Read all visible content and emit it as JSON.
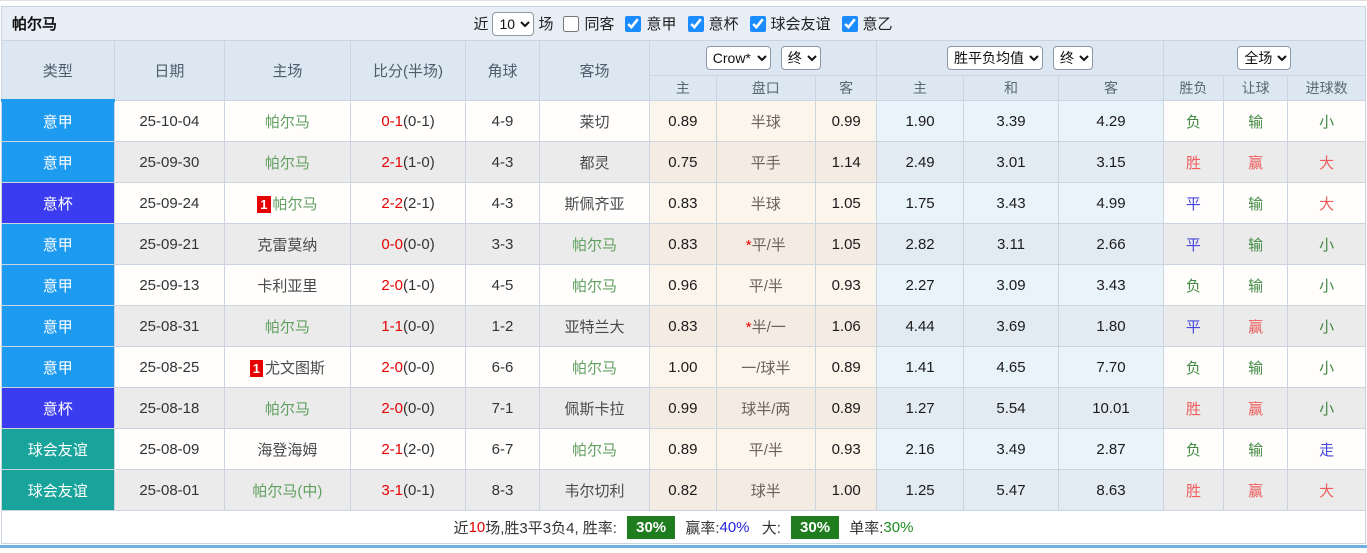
{
  "header": {
    "title": "帕尔马",
    "near_label": "近",
    "near_value": "10",
    "matches_label": "场",
    "same_venue_label": "同客",
    "league_filters": [
      {
        "label": "意甲",
        "checked": true
      },
      {
        "label": "意杯",
        "checked": true
      },
      {
        "label": "球会友谊",
        "checked": true
      },
      {
        "label": "意乙",
        "checked": true
      }
    ]
  },
  "table": {
    "columns": [
      "类型",
      "日期",
      "主场",
      "比分(半场)",
      "角球",
      "客场"
    ],
    "dropdowns": {
      "bookmaker": "Crow*",
      "bookmaker_time": "终",
      "europe": "胜平负均值",
      "europe_time": "终",
      "scope": "全场"
    },
    "sub_columns": [
      "主",
      "盘口",
      "客",
      "主",
      "和",
      "客",
      "胜负",
      "让球",
      "进球数"
    ],
    "rows": [
      {
        "type": "意甲",
        "date": "25-10-04",
        "home_badge": "",
        "home": "帕尔马",
        "home_is_self": true,
        "score": "0-1",
        "half": "(0-1)",
        "corner": "4-9",
        "away": "莱切",
        "away_is_self": false,
        "ah_home": "0.89",
        "handicap_star": "",
        "handicap": "半球",
        "ah_away": "0.99",
        "eu_home": "1.90",
        "eu_draw": "3.39",
        "eu_away": "4.29",
        "result": "负",
        "result_c": "g",
        "let_goal": "输",
        "let_c": "g",
        "goals": "小",
        "goal_c": "g"
      },
      {
        "type": "意甲",
        "date": "25-09-30",
        "home_badge": "",
        "home": "帕尔马",
        "home_is_self": true,
        "score": "2-1",
        "half": "(1-0)",
        "corner": "4-3",
        "away": "都灵",
        "away_is_self": false,
        "ah_home": "0.75",
        "handicap_star": "",
        "handicap": "平手",
        "ah_away": "1.14",
        "eu_home": "2.49",
        "eu_draw": "3.01",
        "eu_away": "3.15",
        "result": "胜",
        "result_c": "r",
        "let_goal": "赢",
        "let_c": "r",
        "goals": "大",
        "goal_c": "r"
      },
      {
        "type": "意杯",
        "date": "25-09-24",
        "home_badge": "1",
        "home": "帕尔马",
        "home_is_self": true,
        "score": "2-2",
        "half": "(2-1)",
        "corner": "4-3",
        "away": "斯佩齐亚",
        "away_is_self": false,
        "ah_home": "0.83",
        "handicap_star": "",
        "handicap": "半球",
        "ah_away": "1.05",
        "eu_home": "1.75",
        "eu_draw": "3.43",
        "eu_away": "4.99",
        "result": "平",
        "result_c": "b",
        "let_goal": "输",
        "let_c": "g",
        "goals": "大",
        "goal_c": "r"
      },
      {
        "type": "意甲",
        "date": "25-09-21",
        "home_badge": "",
        "home": "克雷莫纳",
        "home_is_self": false,
        "score": "0-0",
        "half": "(0-0)",
        "corner": "3-3",
        "away": "帕尔马",
        "away_is_self": true,
        "ah_home": "0.83",
        "handicap_star": "*",
        "handicap": "平/半",
        "ah_away": "1.05",
        "eu_home": "2.82",
        "eu_draw": "3.11",
        "eu_away": "2.66",
        "result": "平",
        "result_c": "b",
        "let_goal": "输",
        "let_c": "g",
        "goals": "小",
        "goal_c": "g"
      },
      {
        "type": "意甲",
        "date": "25-09-13",
        "home_badge": "",
        "home": "卡利亚里",
        "home_is_self": false,
        "score": "2-0",
        "half": "(1-0)",
        "corner": "4-5",
        "away": "帕尔马",
        "away_is_self": true,
        "ah_home": "0.96",
        "handicap_star": "",
        "handicap": "平/半",
        "ah_away": "0.93",
        "eu_home": "2.27",
        "eu_draw": "3.09",
        "eu_away": "3.43",
        "result": "负",
        "result_c": "g",
        "let_goal": "输",
        "let_c": "g",
        "goals": "小",
        "goal_c": "g"
      },
      {
        "type": "意甲",
        "date": "25-08-31",
        "home_badge": "",
        "home": "帕尔马",
        "home_is_self": true,
        "score": "1-1",
        "half": "(0-0)",
        "corner": "1-2",
        "away": "亚特兰大",
        "away_is_self": false,
        "ah_home": "0.83",
        "handicap_star": "*",
        "handicap": "半/一",
        "ah_away": "1.06",
        "eu_home": "4.44",
        "eu_draw": "3.69",
        "eu_away": "1.80",
        "result": "平",
        "result_c": "b",
        "let_goal": "赢",
        "let_c": "r",
        "goals": "小",
        "goal_c": "g"
      },
      {
        "type": "意甲",
        "date": "25-08-25",
        "home_badge": "1",
        "home": "尤文图斯",
        "home_is_self": false,
        "score": "2-0",
        "half": "(0-0)",
        "corner": "6-6",
        "away": "帕尔马",
        "away_is_self": true,
        "ah_home": "1.00",
        "handicap_star": "",
        "handicap": "一/球半",
        "ah_away": "0.89",
        "eu_home": "1.41",
        "eu_draw": "4.65",
        "eu_away": "7.70",
        "result": "负",
        "result_c": "g",
        "let_goal": "输",
        "let_c": "g",
        "goals": "小",
        "goal_c": "g"
      },
      {
        "type": "意杯",
        "date": "25-08-18",
        "home_badge": "",
        "home": "帕尔马",
        "home_is_self": true,
        "score": "2-0",
        "half": "(0-0)",
        "corner": "7-1",
        "away": "佩斯卡拉",
        "away_is_self": false,
        "ah_home": "0.99",
        "handicap_star": "",
        "handicap": "球半/两",
        "ah_away": "0.89",
        "eu_home": "1.27",
        "eu_draw": "5.54",
        "eu_away": "10.01",
        "result": "胜",
        "result_c": "r",
        "let_goal": "赢",
        "let_c": "r",
        "goals": "小",
        "goal_c": "g"
      },
      {
        "type": "球会友谊",
        "date": "25-08-09",
        "home_badge": "",
        "home": "海登海姆",
        "home_is_self": false,
        "score": "2-1",
        "half": "(2-0)",
        "corner": "6-7",
        "away": "帕尔马",
        "away_is_self": true,
        "ah_home": "0.89",
        "handicap_star": "",
        "handicap": "平/半",
        "ah_away": "0.93",
        "eu_home": "2.16",
        "eu_draw": "3.49",
        "eu_away": "2.87",
        "result": "负",
        "result_c": "g",
        "let_goal": "输",
        "let_c": "g",
        "goals": "走",
        "goal_c": "b"
      },
      {
        "type": "球会友谊",
        "date": "25-08-01",
        "home_badge": "",
        "home": "帕尔马(中)",
        "home_is_self": true,
        "score": "3-1",
        "half": "(0-1)",
        "corner": "8-3",
        "away": "韦尔切利",
        "away_is_self": false,
        "ah_home": "0.82",
        "handicap_star": "",
        "handicap": "球半",
        "ah_away": "1.00",
        "eu_home": "1.25",
        "eu_draw": "5.47",
        "eu_away": "8.63",
        "result": "胜",
        "result_c": "r",
        "let_goal": "赢",
        "let_c": "r",
        "goals": "大",
        "goal_c": "r"
      }
    ]
  },
  "footer": {
    "prefix": "近",
    "count": "10",
    "stats": "场,胜3平3负4, 胜率:",
    "win_rate": "30%",
    "win_label": "赢率:",
    "win_value": "40%",
    "big_label": "大:",
    "big_rate": "30%",
    "single_label": "单率:",
    "single_value": "30%"
  },
  "colors": {
    "league": {
      "意甲": "#1d9bf0",
      "意杯": "#3b3bef",
      "球会友谊": "#18a39b"
    },
    "accent_blue": "#1d9bf0",
    "self_team_green": "#61a061",
    "score_red": "#e60000",
    "result_green": "#428a42",
    "result_red": "#ef5d5d",
    "result_blue": "#4545dd",
    "summary_badge_green": "#1f7d1f"
  }
}
